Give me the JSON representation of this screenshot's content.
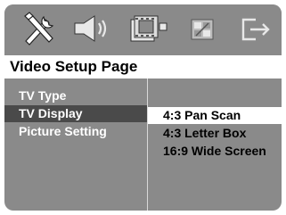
{
  "toolbar": {
    "icons": [
      "tools-icon",
      "speaker-icon",
      "video-film-icon",
      "picture-preferences-icon",
      "exit-icon"
    ]
  },
  "page": {
    "title": "Video Setup Page"
  },
  "left_menu": {
    "items": [
      {
        "label": "TV Type"
      },
      {
        "label": "TV Display",
        "selected": true
      },
      {
        "label": "Picture Setting"
      }
    ]
  },
  "right_menu": {
    "items": [
      {
        "label": "4:3 Pan Scan",
        "selected": true
      },
      {
        "label": "4:3 Letter Box"
      },
      {
        "label": "16:9 Wide Screen"
      }
    ]
  },
  "colors": {
    "panel_bg": "#8a8a8a",
    "left_highlight": "#4a4a4a",
    "right_highlight": "#ffffff",
    "menu_text": "#ffffff"
  }
}
